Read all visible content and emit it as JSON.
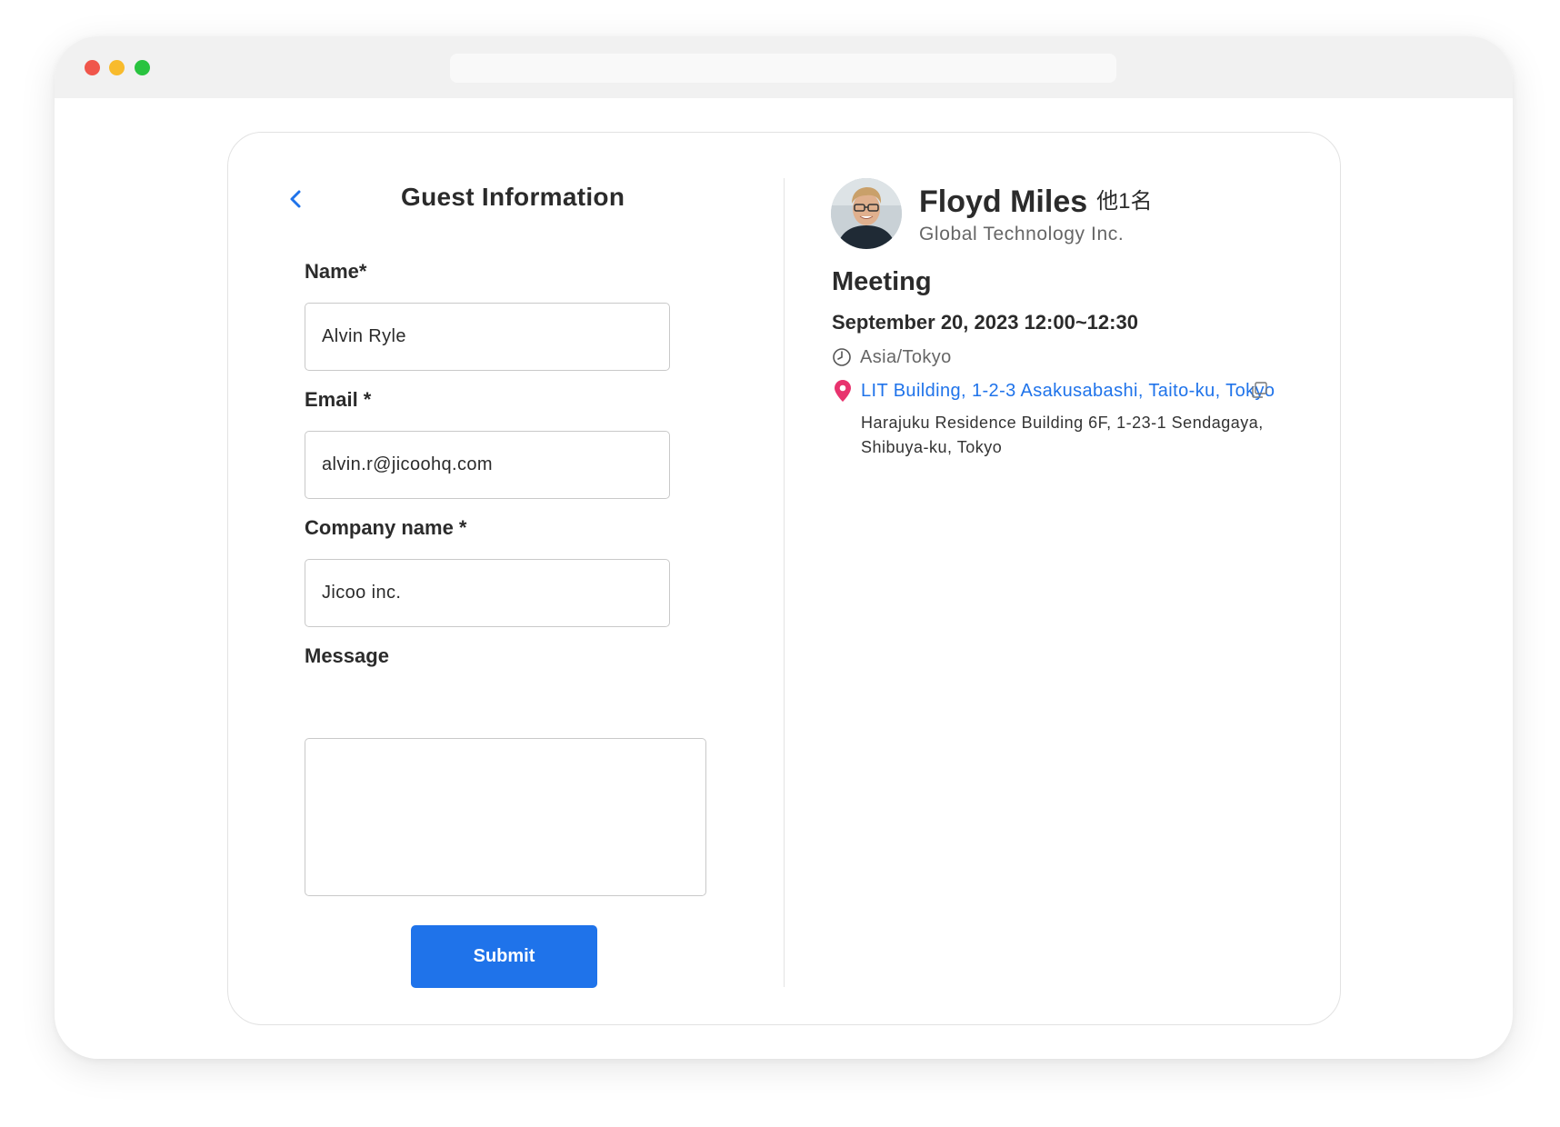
{
  "window": {
    "traffic_lights": [
      "close",
      "minimize",
      "maximize"
    ],
    "address_bar_value": ""
  },
  "form": {
    "title": "Guest Information",
    "back_icon": "chevron-left-icon",
    "fields": {
      "name": {
        "label": "Name*",
        "value": "Alvin Ryle"
      },
      "email": {
        "label": "Email *",
        "value": "alvin.r@jicoohq.com"
      },
      "company": {
        "label": "Company name *",
        "value": "Jicoo inc."
      },
      "message": {
        "label": "Message",
        "value": ""
      }
    },
    "submit_label": "Submit"
  },
  "host": {
    "name": "Floyd Miles",
    "extra": "他1名",
    "company": "Global Technology Inc."
  },
  "meeting": {
    "title": "Meeting",
    "datetime": "September 20, 2023 12:00~12:30",
    "timezone": "Asia/Tokyo",
    "location_link": "LIT Building, 1-2-3 Asakusabashi, Taito-ku, Tokyo",
    "location_detail": "Harajuku Residence Building 6F, 1-23-1 Sendagaya, Shibuya-ku, Tokyo"
  },
  "colors": {
    "accent": "#1f73ea",
    "pin": "#e8336e",
    "text": "#2b2b2b",
    "muted": "#666666"
  }
}
